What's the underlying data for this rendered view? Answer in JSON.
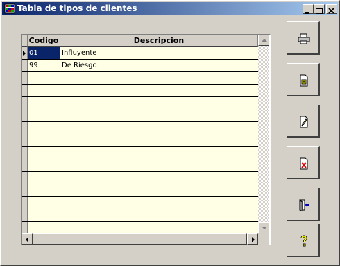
{
  "window": {
    "title": "Tabla de tipos de clientes"
  },
  "grid": {
    "columns": [
      "Codigo",
      "Descripcion"
    ],
    "rows": [
      {
        "codigo": "01",
        "descripcion": "Influyente",
        "selected": true
      },
      {
        "codigo": "99",
        "descripcion": "De Riesgo",
        "selected": false
      }
    ],
    "empty_rows": 14,
    "colors": {
      "row_bg": "#ffffe6",
      "selection": "#0a246a"
    }
  },
  "toolbar": {
    "buttons": [
      {
        "name": "print-button",
        "icon": "printer-icon"
      },
      {
        "name": "add-button",
        "icon": "new-document-icon"
      },
      {
        "name": "edit-button",
        "icon": "edit-document-icon"
      },
      {
        "name": "delete-button",
        "icon": "delete-document-icon"
      },
      {
        "name": "exit-button",
        "icon": "exit-door-icon"
      },
      {
        "name": "help-button",
        "icon": "help-icon"
      }
    ]
  }
}
